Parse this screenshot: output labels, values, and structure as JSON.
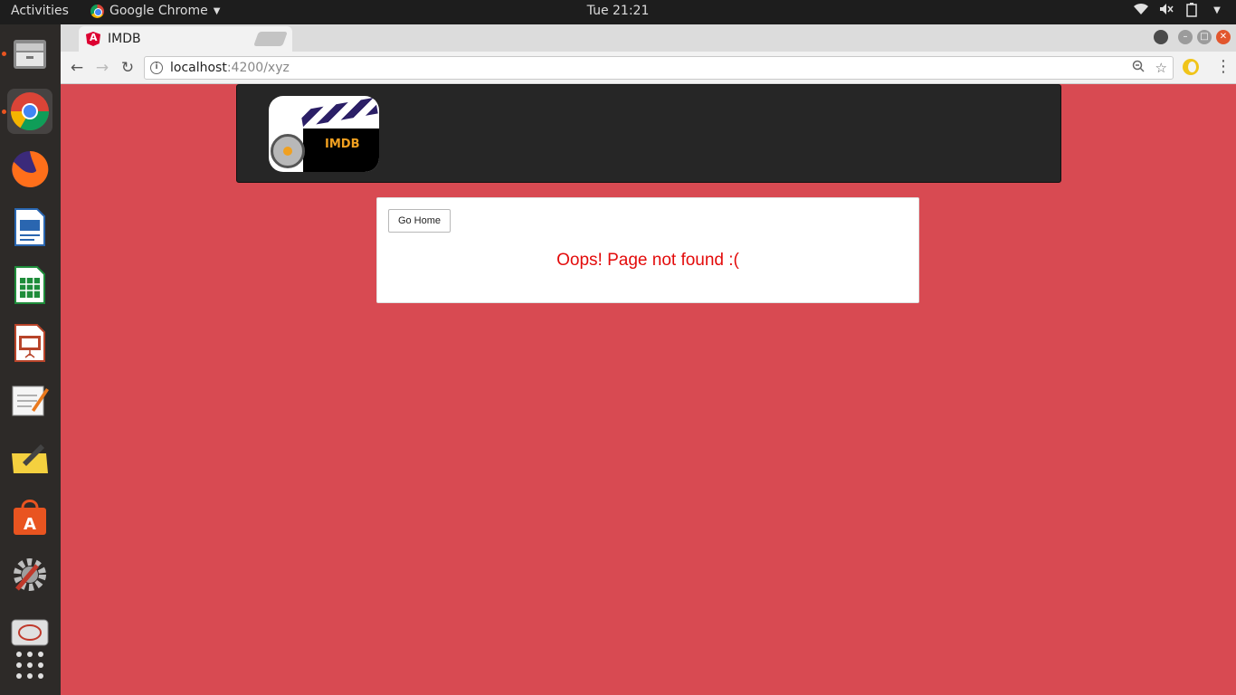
{
  "system": {
    "activities": "Activities",
    "app_name": "Google Chrome",
    "clock": "Tue 21:21"
  },
  "browser": {
    "tab_title": "IMDB",
    "url_host": "localhost",
    "url_path": ":4200/xyz"
  },
  "page": {
    "logo_text": "IMDB",
    "go_home_label": "Go Home",
    "error_message": "Oops! Page not found :("
  },
  "colors": {
    "page_background": "#d84a52",
    "header_background": "#262626",
    "error_text": "#e30b0b"
  },
  "dock_icons": [
    "files-icon",
    "chrome-icon",
    "firefox-icon",
    "writer-icon",
    "calc-icon",
    "impress-icon",
    "text-editor-icon",
    "notes-icon",
    "software-center-icon",
    "settings-icon",
    "screen-recorder-icon",
    "app-grid-icon"
  ]
}
